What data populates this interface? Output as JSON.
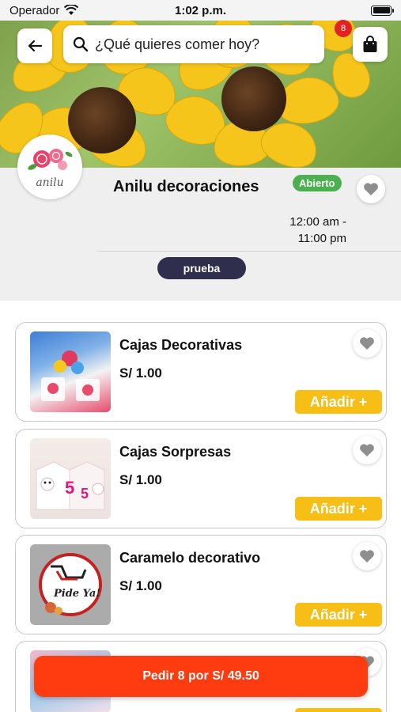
{
  "status_bar": {
    "carrier": "Operador",
    "time": "1:02 p.m."
  },
  "header": {
    "search_placeholder": "¿Qué quieres comer hoy?",
    "cart_count": "8"
  },
  "store": {
    "logo_text": "anilu",
    "name": "Anilu decoraciones",
    "status": "Abierto",
    "hours_open": "12:00 am -",
    "hours_close": "11:00 pm",
    "tag": "prueba"
  },
  "products": [
    {
      "name": "Cajas Decorativas",
      "price": "S/ 1.00",
      "add_label": "Añadir +"
    },
    {
      "name": "Cajas Sorpresas",
      "price": "S/ 1.00",
      "add_label": "Añadir +"
    },
    {
      "name": "Caramelo decorativo",
      "price": "S/ 1.00",
      "add_label": "Añadir +"
    },
    {
      "name": "",
      "price": "",
      "add_label": ""
    }
  ],
  "thumb3_text": "Pide Ya!",
  "order_button": "Pedir 8 por S/ 49.50",
  "colors": {
    "accent_orange": "#ff3b0f",
    "add_button_yellow": "#f7be16",
    "open_green": "#4caf50",
    "tag_dark": "#2f2e4c",
    "cart_badge_red": "#e32222"
  }
}
